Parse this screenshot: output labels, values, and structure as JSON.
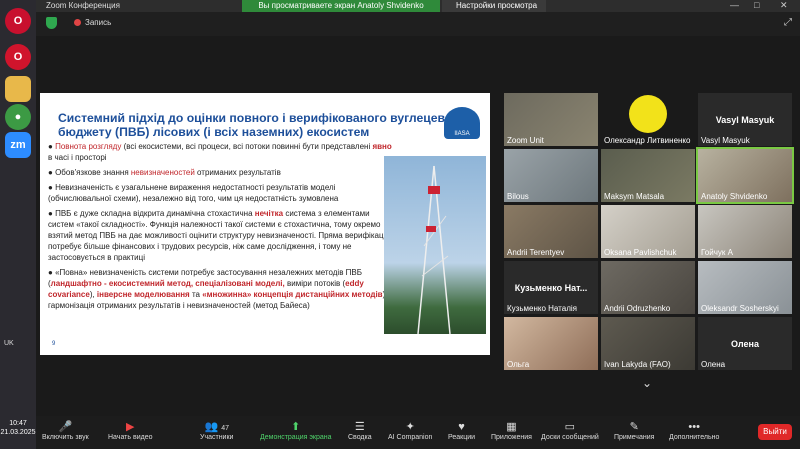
{
  "window": {
    "title": "Zoom Конференция",
    "share_banner": "Вы просматриваете экран Anatoly Shvidenko",
    "view_settings": "Настройки просмотра"
  },
  "topbar": {
    "recording_label": "Запись"
  },
  "slide": {
    "title": "Системний підхід до оцінки повного і верифікованого вуглецевого бюджету (ПВБ) лісових (і всіх наземних) екосистем",
    "logo_text": "IIASA",
    "page_number": "9",
    "b1_red": "Повнота розгляду",
    "b1_rest": " (всі екосистеми, всі процеси, всі потоки повинні бути представлені ",
    "b1_red2": "явно",
    "b1_end": " в часі і просторі",
    "b2_start": "Обов'язкове знання ",
    "b2_red": "невизначеностей",
    "b2_end": " отриманих результатів",
    "b3": "Невизначеність є узагальнене вираження недостатності результатів моделі (обчислювальної схеми), незалежно від того, чим ця недостатність зумовлена",
    "b4_start": "ПВБ є дуже складна  відкрита динамічна стохастична ",
    "b4_red": "нечітка",
    "b4_rest": " система  з елементами систем «такої складності». Функція належності такої системи є стохастична, тому окремо взятий метод ПВБ на дає можливості оцінити структуру невизначеності. Пряма верифікація потребує більше фінансових і трудових ресурсів, ніж саме дослідження, і тому не застосовується в практиці",
    "b5_start": "«Повна» невизначеність системи потребує застосування незалежних методів ПВБ (",
    "b5_red1": "ландшафтно - екосистемний метод, спеціалізовані моделі,",
    "b5_mid1": " виміри потоків (",
    "b5_red2": "eddy covariance",
    "b5_mid2": "), ",
    "b5_red3": "інверсне моделювання",
    "b5_mid3": " та ",
    "b5_red4": "«множинна» концепція дистанційних методів",
    "b5_end": "), гармонізація отриманих результатів і невизначеностей (метод Байеса)"
  },
  "participants": [
    "Zoom Unit",
    "Олександр Литвиненко",
    "Vasyl Masyuk",
    "Bilous",
    "Maksym Matsala",
    "Anatoly Shvidenko",
    "Andrii Terentyev",
    "Oksana Pavlishchuk",
    "Гойчук А",
    "Кузьменко Наталія",
    "Andrii Odruzhenko",
    "Oleksandr Sosherskyi",
    "Ольга",
    "Ivan Lakyda (FAO)",
    "Олена"
  ],
  "tile_center_names": {
    "vasyl": "Vasyl Masyuk",
    "kuzmenko": "Кузьменко   Нат...",
    "olena": "Олена"
  },
  "toolbar": {
    "mute": "Включить звук",
    "video": "Начать видео",
    "participants": "Участники",
    "participants_count": "47",
    "share": "Демонстрация экрана",
    "summary": "Сводка",
    "ai": "AI Companion",
    "reactions": "Реакции",
    "apps": "Приложения",
    "messages": "Доски сообщений",
    "notes": "Примечания",
    "more": "Дополнительно",
    "leave": "Выйти"
  },
  "system": {
    "time": "10:47",
    "date": "21.03.2025",
    "lang": "UK"
  },
  "colors": {
    "share_green": "#2f8a3a",
    "leave_red": "#e02828",
    "slide_title": "#1d4f9a",
    "active_outline": "#7ac943"
  }
}
